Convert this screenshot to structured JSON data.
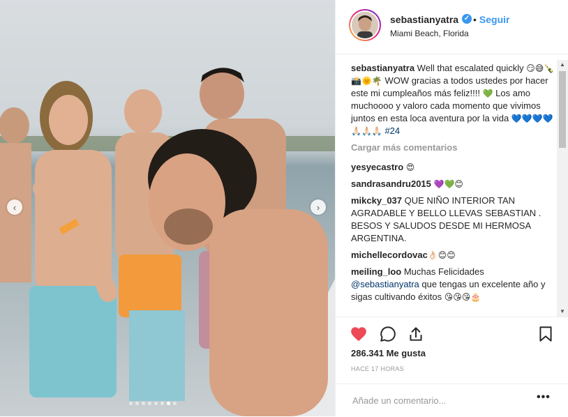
{
  "post": {
    "username": "sebastianyatra",
    "verified_icon": "✓",
    "separator": "•",
    "follow_label": "Seguir",
    "location": "Miami Beach, Florida"
  },
  "caption": {
    "user": "sebastianyatra",
    "text_1": " Well that escalated quickly ",
    "emoji_1": "😏😅🍾📸🌞🌴",
    "text_2": " WOW gracias a todos ustedes por hacer este mi cumpleaños más feliz!!!! ",
    "emoji_2": "💚",
    "text_3": " Los amo muchoooo y valoro cada momento que vivimos juntos en esta loca aventura por la vida ",
    "emoji_3": "💙💙💙💙🙏🏻🙏🏻🙏🏻",
    "hashtag": "#24"
  },
  "load_more_label": "Cargar más comentarios",
  "comments": [
    {
      "user": "yesyecastro",
      "text": "",
      "emoji": "😍"
    },
    {
      "user": "sandrasandru2015",
      "text": "",
      "emoji": "💜💚😊"
    },
    {
      "user": "mikcky_037",
      "text": " QUE NIÑO INTERIOR TAN AGRADABLE Y BELLO LLEVAS SEBASTIAN . BESOS Y SALUDOS DESDE MI HERMOSA ARGENTINA.",
      "emoji": ""
    },
    {
      "user": "michellecordovac",
      "text": "",
      "emoji": "👌🏻😊😊"
    },
    {
      "user": "meiling_loo",
      "text": " Muchas Felicidades ",
      "mention": "@sebastianyatra",
      "text_2": " que tengas un excelente año y sigas cultivando éxitos ",
      "emoji": "😘😘😘🎂"
    }
  ],
  "actions": {
    "likes": "286.341 Me gusta",
    "time": "HACE 17 HORAS",
    "comment_placeholder": "Añade un comentario...",
    "more_label": "•••",
    "like_color": "#ed4956"
  },
  "carousel": {
    "prev_icon": "‹",
    "next_icon": "›",
    "dot_count": 8,
    "active_dot": 6
  },
  "colors": {
    "link": "#3897f0",
    "text": "#262626",
    "muted": "#999999"
  }
}
